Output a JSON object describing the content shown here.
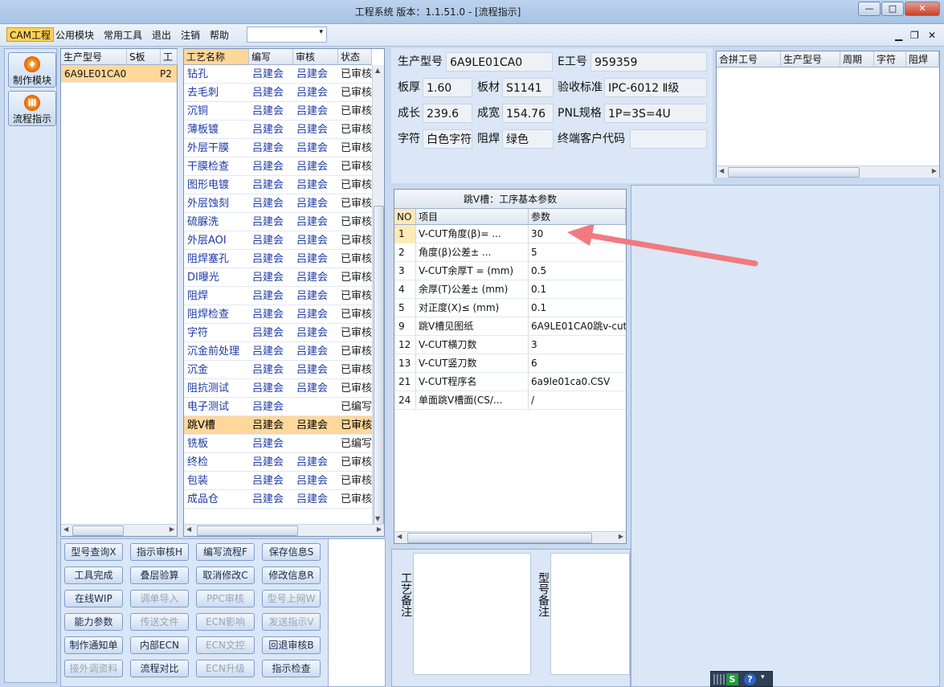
{
  "window": {
    "title": "工程系统   版本：1.1.51.0 - [流程指示]",
    "min": "—",
    "max": "□",
    "close": "✕"
  },
  "menu": {
    "items": [
      "CAM工程",
      "公用模块",
      "常用工具",
      "退出",
      "注销",
      "帮助"
    ],
    "combo_arrow": "▾",
    "mdi_min": "▁",
    "mdi_restore": "❐",
    "mdi_close": "✕"
  },
  "modules": [
    "制作模块",
    "流程指示"
  ],
  "model_grid": {
    "headers": [
      "生产型号",
      "S板",
      "工厂"
    ],
    "rows": [
      [
        "6A9LE01CA0",
        "",
        "P2"
      ]
    ]
  },
  "process_grid": {
    "headers": [
      "工艺名称",
      "编写",
      "审核",
      "状态"
    ],
    "rows": [
      [
        "钻孔",
        "吕建会",
        "吕建会",
        "已审核"
      ],
      [
        "去毛刺",
        "吕建会",
        "吕建会",
        "已审核"
      ],
      [
        "沉铜",
        "吕建会",
        "吕建会",
        "已审核"
      ],
      [
        "薄板镀",
        "吕建会",
        "吕建会",
        "已审核"
      ],
      [
        "外层干膜",
        "吕建会",
        "吕建会",
        "已审核"
      ],
      [
        "干膜检查",
        "吕建会",
        "吕建会",
        "已审核"
      ],
      [
        "图形电镀",
        "吕建会",
        "吕建会",
        "已审核"
      ],
      [
        "外层蚀刻",
        "吕建会",
        "吕建会",
        "已审核"
      ],
      [
        "硫脲洗",
        "吕建会",
        "吕建会",
        "已审核"
      ],
      [
        "外层AOI",
        "吕建会",
        "吕建会",
        "已审核"
      ],
      [
        "阻焊塞孔",
        "吕建会",
        "吕建会",
        "已审核"
      ],
      [
        "DI曝光",
        "吕建会",
        "吕建会",
        "已审核"
      ],
      [
        "阻焊",
        "吕建会",
        "吕建会",
        "已审核"
      ],
      [
        "阻焊检查",
        "吕建会",
        "吕建会",
        "已审核"
      ],
      [
        "字符",
        "吕建会",
        "吕建会",
        "已审核"
      ],
      [
        "沉金前处理",
        "吕建会",
        "吕建会",
        "已审核"
      ],
      [
        "沉金",
        "吕建会",
        "吕建会",
        "已审核"
      ],
      [
        "阻抗测试",
        "吕建会",
        "吕建会",
        "已审核"
      ],
      [
        "电子测试",
        "吕建会",
        "",
        "已编写"
      ],
      [
        "跳V槽",
        "吕建会",
        "吕建会",
        "已审核"
      ],
      [
        "铣板",
        "吕建会",
        "",
        "已编写"
      ],
      [
        "终检",
        "吕建会",
        "吕建会",
        "已审核"
      ],
      [
        "包装",
        "吕建会",
        "吕建会",
        "已审核"
      ],
      [
        "成品仓",
        "吕建会",
        "吕建会",
        "已审核"
      ]
    ],
    "selected_index": 19
  },
  "buttons": [
    [
      {
        "label": "型号查询X",
        "enabled": true
      },
      {
        "label": "指示审核H",
        "enabled": true
      },
      {
        "label": "编写流程F",
        "enabled": true
      },
      {
        "label": "保存信息S",
        "enabled": true
      }
    ],
    [
      {
        "label": "工具完成",
        "enabled": true
      },
      {
        "label": "叠层验算",
        "enabled": true
      },
      {
        "label": "取消修改C",
        "enabled": true
      },
      {
        "label": "修改信息R",
        "enabled": true
      }
    ],
    [
      {
        "label": "在线WIP",
        "enabled": true
      },
      {
        "label": "调单导入",
        "enabled": false
      },
      {
        "label": "PPC审核",
        "enabled": false
      },
      {
        "label": "型号上网W",
        "enabled": false
      }
    ],
    [
      {
        "label": "能力参数",
        "enabled": true
      },
      {
        "label": "传送文件",
        "enabled": false
      },
      {
        "label": "ECN影响",
        "enabled": false
      },
      {
        "label": "发送指示V",
        "enabled": false
      }
    ],
    [
      {
        "label": "制作通知单",
        "enabled": true
      },
      {
        "label": "内部ECN",
        "enabled": true
      },
      {
        "label": "ECN文控",
        "enabled": false
      },
      {
        "label": "回退审核B",
        "enabled": true
      }
    ],
    [
      {
        "label": "接外调资料",
        "enabled": false
      },
      {
        "label": "流程对比",
        "enabled": true
      },
      {
        "label": "ECN升级",
        "enabled": false
      },
      {
        "label": "指示检查",
        "enabled": true
      }
    ]
  ],
  "info": {
    "model_label": "生产型号",
    "model_value": "6A9LE01CA0",
    "e_label": "E工号",
    "e_value": "959359",
    "thick_label": "板厚",
    "thick_value": "1.60",
    "mat_label": "板材",
    "mat_value": "S1141",
    "std_label": "验收标准",
    "std_value": "IPC-6012 Ⅱ级",
    "len_label": "成长",
    "len_value": "239.6",
    "wid_label": "成宽",
    "wid_value": "154.76",
    "pnl_label": "PNL规格",
    "pnl_value": "1P=3S=4U",
    "char_label": "字符",
    "char_value": "白色字符",
    "mask_label": "阻焊",
    "mask_value": "绿色",
    "cust_label": "终端客户代码",
    "cust_value": ""
  },
  "merge_grid": {
    "headers": [
      "合拼工号",
      "生产型号",
      "周期",
      "字符",
      "阻焊"
    ]
  },
  "param_grid": {
    "title": "跳V槽：工序基本参数",
    "headers": [
      "NO",
      "项目",
      "参数"
    ],
    "rows": [
      [
        "1",
        "V-CUT角度(β)=  ...",
        "30"
      ],
      [
        "2",
        "角度(β)公差±  ...",
        "5"
      ],
      [
        "3",
        "V-CUT余厚T =  (mm)",
        "0.5"
      ],
      [
        "4",
        "余厚(T)公差±  (mm)",
        "0.1"
      ],
      [
        "5",
        "对正度(X)≤ (mm)",
        "0.1"
      ],
      [
        "9",
        "跳V槽见图纸",
        "6A9LE01CA0跳v-cut"
      ],
      [
        "12",
        "V-CUT横刀数",
        "3"
      ],
      [
        "13",
        "V-CUT竖刀数",
        "6"
      ],
      [
        "21",
        "V-CUT程序名",
        "6a9le01ca0.CSV"
      ],
      [
        "24",
        "单面跳V槽面(CS/...",
        "/"
      ]
    ]
  },
  "notes": {
    "process_label": "工艺备注",
    "model_label": "型号备注"
  },
  "colors": {
    "selection": "#fed79a",
    "panel": "#dbe7f6",
    "arrow": "#f07a80"
  }
}
